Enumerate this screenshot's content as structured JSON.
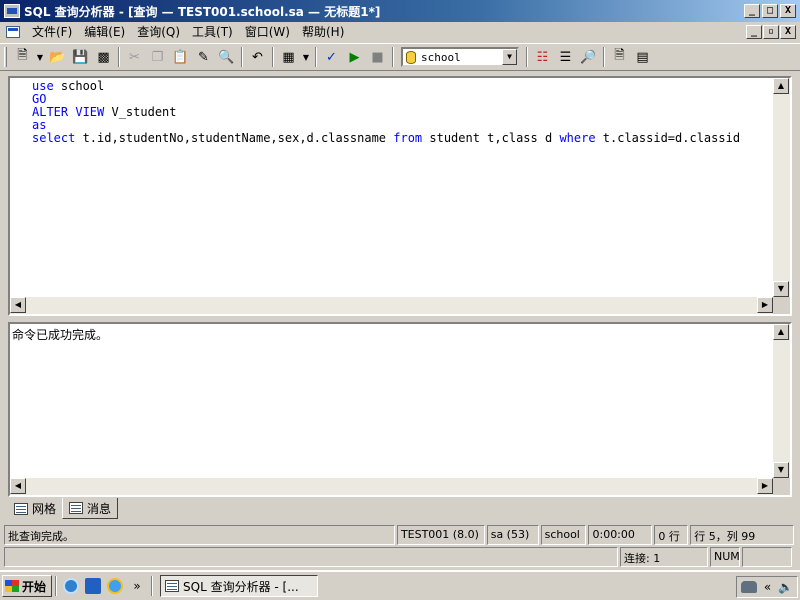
{
  "window": {
    "title": "SQL 查询分析器 - [查询 — TEST001.school.sa — 无标题1*]",
    "minimize_glyph": "_",
    "maximize_glyph": "□",
    "close_glyph": "X"
  },
  "mdi": {
    "minimize_glyph": "_",
    "restore_glyph": "▫",
    "close_glyph": "X"
  },
  "menu": [
    {
      "label": "文件(F)"
    },
    {
      "label": "编辑(E)"
    },
    {
      "label": "查询(Q)"
    },
    {
      "label": "工具(T)"
    },
    {
      "label": "窗口(W)"
    },
    {
      "label": "帮助(H)"
    }
  ],
  "toolbar": {
    "database": "school"
  },
  "editor": {
    "lines": [
      {
        "kw": "use",
        "rest": " school"
      },
      {
        "kw": "GO",
        "rest": ""
      },
      {
        "kw": "ALTER VIEW",
        "rest": " V_student"
      },
      {
        "kw": "as",
        "rest": ""
      },
      {
        "kw": "select",
        "rest": " t.id,studentNo,studentName,sex,d.classname ",
        "kw2": "from",
        "rest2": " student t,class d ",
        "kw3": "where",
        "rest3": " t.classid=d.classid"
      }
    ]
  },
  "results": {
    "message": "命令已成功完成。"
  },
  "tabs": [
    {
      "label": "网格"
    },
    {
      "label": "消息"
    }
  ],
  "status": {
    "message": "批查询完成。",
    "server": "TEST001 (8.0)",
    "user": "sa (53)",
    "database": "school",
    "elapsed": "0:00:00",
    "rows": "0 行",
    "position": "行 5，列 99",
    "connections": "连接: 1",
    "num": "NUM"
  },
  "taskbar": {
    "start": "开始",
    "more_glyph": "»",
    "task": "SQL 查询分析器 - [...",
    "tray_glyph": "«"
  }
}
